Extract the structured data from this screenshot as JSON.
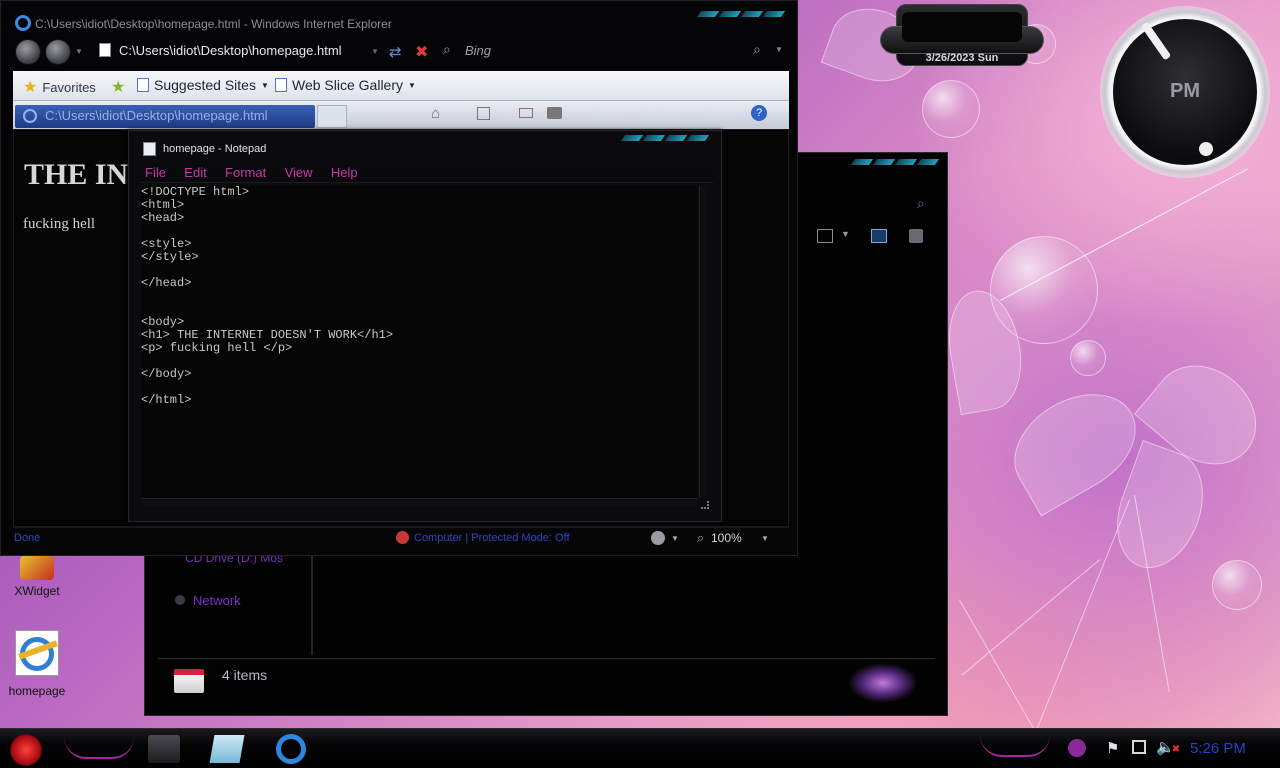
{
  "desktop": {
    "icons": [
      {
        "label": "XWidget"
      },
      {
        "label": "homepage"
      }
    ],
    "clock_widget": {
      "meridiem": "PM"
    },
    "date_widget": {
      "date": "3/26/2023 Sun"
    }
  },
  "ie": {
    "title": "C:\\Users\\idiot\\Desktop\\homepage.html - Windows Internet Explorer",
    "address": "C:\\Users\\idiot\\Desktop\\homepage.html",
    "search_provider": "Bing",
    "favorites_bar": {
      "favorites_label": "Favorites",
      "suggested_sites": "Suggested Sites",
      "web_slice_gallery": "Web Slice Gallery"
    },
    "tab_title": "C:\\Users\\idiot\\Desktop\\homepage.html",
    "command_bar": {
      "page": "Page",
      "safety": "Safety",
      "tools": "Tools"
    },
    "page": {
      "heading": "THE IN",
      "paragraph": "fucking hell"
    },
    "status": {
      "left": "Done",
      "zone": "Computer | Protected Mode: Off",
      "zoom": "100%"
    }
  },
  "notepad": {
    "title": "homepage - Notepad",
    "menu": [
      "File",
      "Edit",
      "Format",
      "View",
      "Help"
    ],
    "text": "<!DOCTYPE html>\n<html>\n<head>\n\n<style>\n</style>\n\n</head>\n\n\n<body>\n<h1> THE INTERNET DOESN'T WORK</h1>\n<p> fucking hell </p>\n\n</body>\n\n</html>"
  },
  "explorer": {
    "nav_items": [
      {
        "label": "CD Drive (D:) Mos"
      },
      {
        "label": "Network"
      }
    ],
    "status": {
      "items_count": "4 items"
    }
  },
  "taskbar": {
    "time": "5:26 PM"
  },
  "colors": {
    "accent_magenta": "#c63aa7",
    "status_blue": "#2e46c7",
    "wallpaper_pink": "#e79ac7",
    "wallpaper_purple": "#7a3f9c"
  }
}
